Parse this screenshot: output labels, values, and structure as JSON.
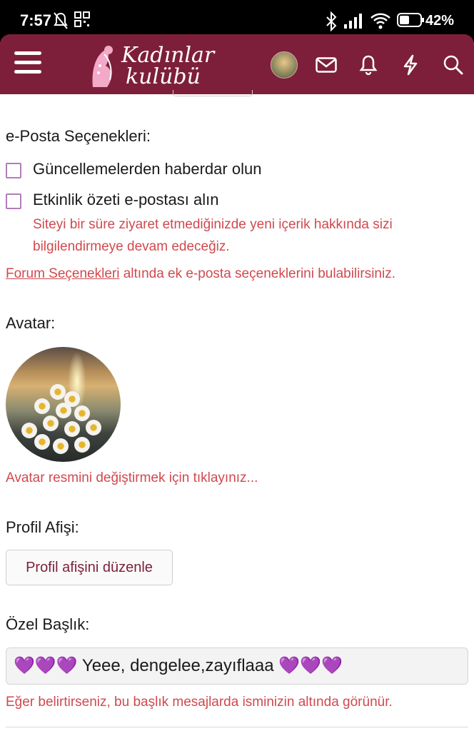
{
  "status_bar": {
    "time": "7:57",
    "battery": "42%"
  },
  "header": {
    "logo_line1": "Kadınlar",
    "logo_line2": "kulübü",
    "colors": {
      "bar": "#7d1f3a"
    },
    "icons": [
      "menu-icon",
      "avatar",
      "mail-icon",
      "bell-icon",
      "lightning-icon",
      "search-icon"
    ]
  },
  "email_options": {
    "title": "e-Posta Seçenekleri:",
    "checkbox1": "Güncellemelerden haberdar olun",
    "checkbox2": "Etkinlik özeti e-postası alın",
    "checkbox2_hint": "Siteyi bir süre ziyaret etmediğinizde yeni içerik hakkında sizi bilgilendirmeye devam edeceğiz.",
    "forum_link": "Forum Seçenekleri",
    "forum_hint": " altında ek e-posta seçeneklerini bulabilirsiniz."
  },
  "avatar": {
    "title": "Avatar:",
    "hint": "Avatar resmini değiştirmek için tıklayınız..."
  },
  "banner": {
    "title": "Profil Afişi:",
    "button": "Profil afişini düzenle"
  },
  "custom_title": {
    "title": "Özel Başlık:",
    "hearts_left": "💜💜💜",
    "value": " Yeee, dengelee,zayıflaaa ",
    "hearts_right": "💜💜💜",
    "hint": "Eğer belirtirseniz, bu başlık mesajlarda isminizin altında görünür."
  },
  "colors": {
    "hint": "#d0494e",
    "accent": "#7d1f3a",
    "checkbox": "#b27db8"
  }
}
